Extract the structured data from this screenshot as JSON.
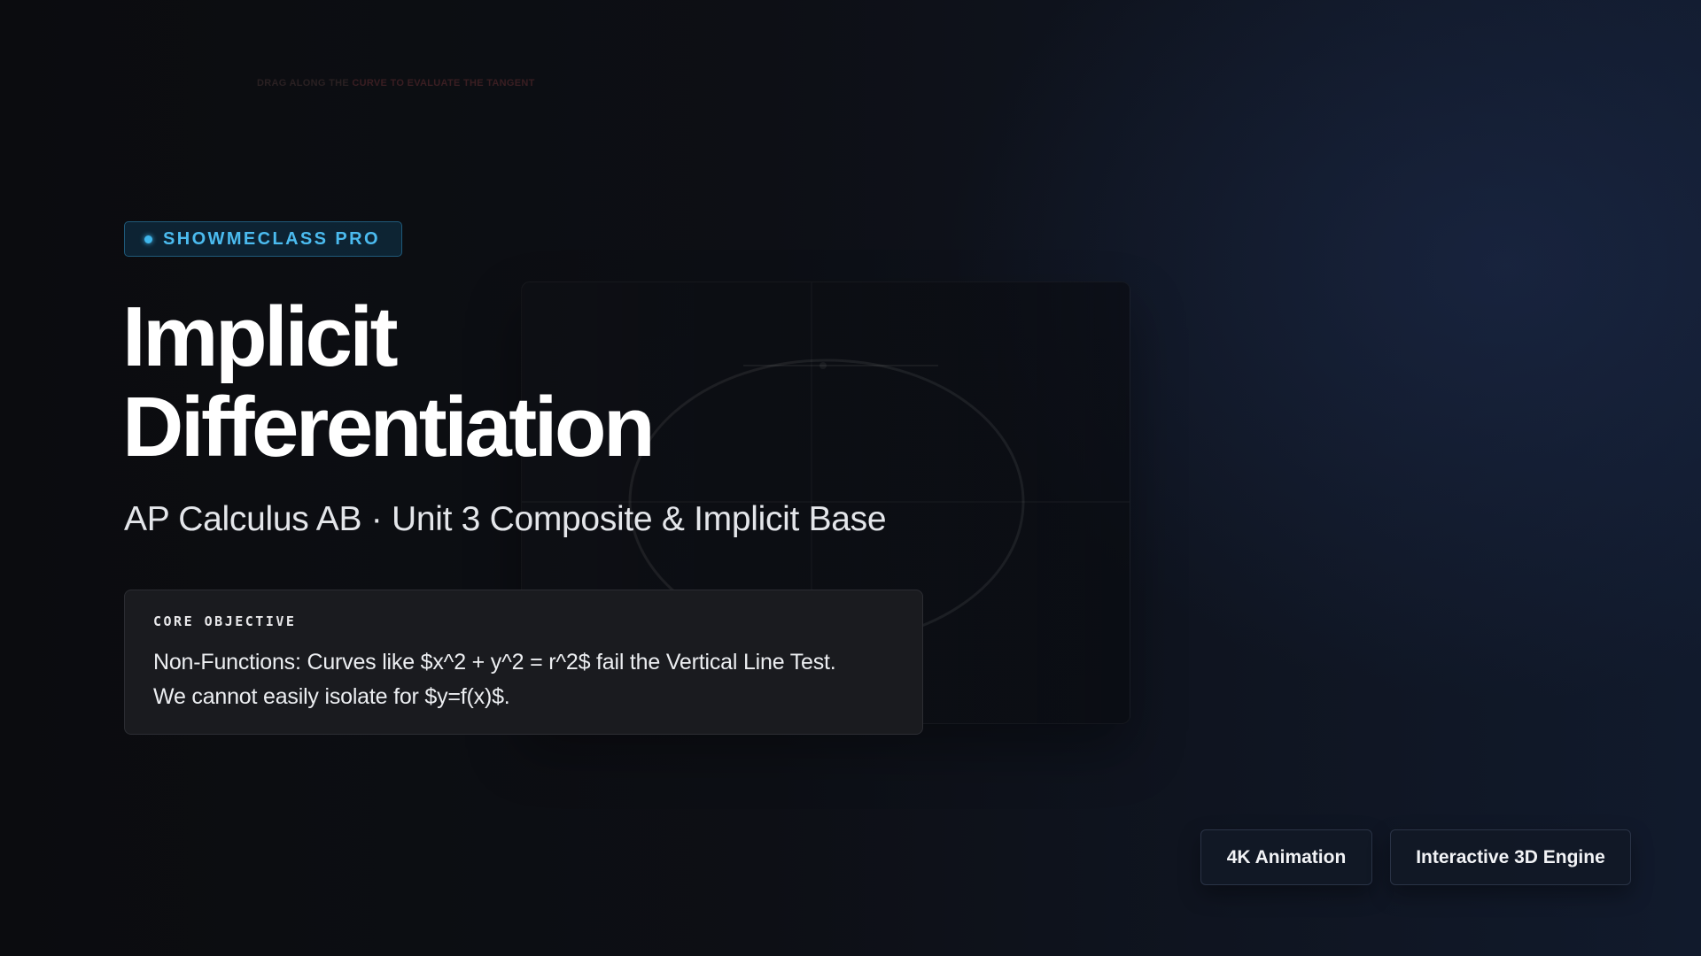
{
  "hint": {
    "part1": "DRAG ALONG THE ",
    "part2": "CURVE TO EVALUATE THE TANGENT"
  },
  "badge": {
    "label": "SHOWMECLASS PRO",
    "color": "#3fb7ec"
  },
  "title": {
    "line1": "Implicit",
    "line2": "Differentiation"
  },
  "subtitle": "AP Calculus AB · Unit 3 Composite & Implicit Base",
  "objective": {
    "label": "CORE OBJECTIVE",
    "line1": "Non-Functions: Curves like $x^2 + y^2 = r^2$ fail the Vertical Line Test.",
    "line2": "We cannot easily isolate for $y=f(x)$."
  },
  "features": [
    {
      "label": "4K Animation"
    },
    {
      "label": "Interactive 3D Engine"
    }
  ],
  "colors": {
    "accent": "#3fb7ec",
    "background": "#0c0d11"
  }
}
